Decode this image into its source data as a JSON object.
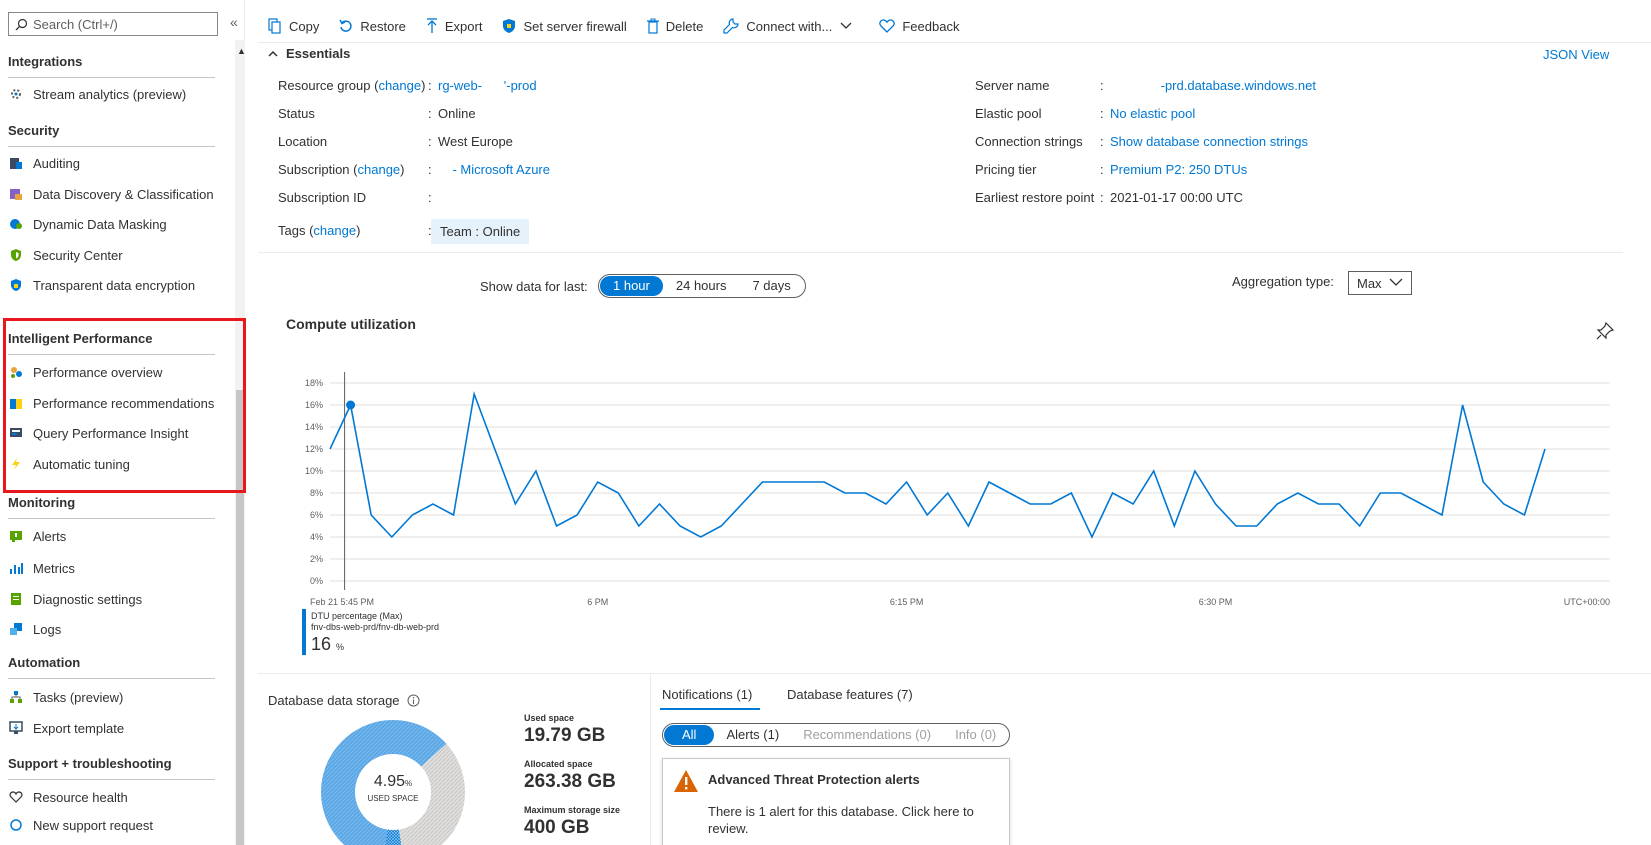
{
  "sidebar": {
    "search_placeholder": "Search (Ctrl+/)",
    "collapse": "«",
    "sections": [
      {
        "title": "Integrations",
        "items": [
          "Stream analytics (preview)"
        ]
      },
      {
        "title": "Security",
        "items": [
          "Auditing",
          "Data Discovery & Classification",
          "Dynamic Data Masking",
          "Security Center",
          "Transparent data encryption"
        ]
      },
      {
        "title": "Intelligent Performance",
        "items": [
          "Performance overview",
          "Performance recommendations",
          "Query Performance Insight",
          "Automatic tuning"
        ]
      },
      {
        "title": "Monitoring",
        "items": [
          "Alerts",
          "Metrics",
          "Diagnostic settings",
          "Logs"
        ]
      },
      {
        "title": "Automation",
        "items": [
          "Tasks (preview)",
          "Export template"
        ]
      },
      {
        "title": "Support + troubleshooting",
        "items": [
          "Resource health",
          "New support request"
        ]
      }
    ]
  },
  "toolbar": {
    "copy": "Copy",
    "restore": "Restore",
    "export": "Export",
    "firewall": "Set server firewall",
    "delete": "Delete",
    "connect": "Connect with...",
    "feedback": "Feedback"
  },
  "essentials": {
    "title": "Essentials",
    "json_view": "JSON View",
    "change": "change",
    "resource_group_label": "Resource group",
    "resource_group": "rg-web-   '-prod",
    "status_label": "Status",
    "status": "Online",
    "location_label": "Location",
    "location": "West Europe",
    "subscription_label": "Subscription",
    "subscription": "  - Microsoft Azure",
    "subscription_id_label": "Subscription ID",
    "subscription_id": "",
    "tags_label": "Tags",
    "tag": "Team : Online",
    "server_name_label": "Server name",
    "server_name": "       -prd.database.windows.net",
    "elastic_pool_label": "Elastic pool",
    "elastic_pool": "No elastic pool",
    "conn_label": "Connection strings",
    "conn": "Show database connection strings",
    "pricing_label": "Pricing tier",
    "pricing": "Premium P2: 250 DTUs",
    "restore_label": "Earliest restore point",
    "restore_point": "2021-01-17 00:00 UTC"
  },
  "controls": {
    "show_label": "Show data for last:",
    "ranges": [
      "1 hour",
      "24 hours",
      "7 days"
    ],
    "agg_label": "Aggregation type:",
    "agg_value": "Max"
  },
  "chart_data": {
    "type": "line",
    "title": "Compute utilization",
    "yticks": [
      "18%",
      "16%",
      "14%",
      "12%",
      "10%",
      "8%",
      "6%",
      "4%",
      "2%",
      "0%"
    ],
    "ylim": [
      0,
      18
    ],
    "xticks": [
      "Feb 21 5:45 PM",
      "6 PM",
      "6:15 PM",
      "6:30 PM"
    ],
    "timezone": "UTC+00:00",
    "series": [
      {
        "name": "DTU percentage (Max)",
        "values": [
          12,
          16,
          6,
          4,
          6,
          7,
          6,
          17,
          12,
          7,
          10,
          5,
          6,
          9,
          8,
          5,
          7,
          5,
          4,
          5,
          7,
          9,
          9,
          9,
          9,
          8,
          8,
          7,
          9,
          6,
          8,
          5,
          9,
          8,
          7,
          7,
          8,
          4,
          8,
          7,
          10,
          5,
          10,
          7,
          5,
          5,
          7,
          8,
          7,
          7,
          5,
          8,
          8,
          7,
          6,
          16,
          9,
          7,
          6,
          12
        ]
      }
    ],
    "cursor_index": 1,
    "legend": {
      "metric": "DTU percentage (Max)",
      "resource": "fnv-dbs-web-prd/fnv-db-web-prd",
      "value": "16",
      "unit": "%"
    }
  },
  "storage": {
    "title": "Database data storage",
    "percent": "4.95",
    "percent_unit": "%",
    "used_caption": "USED SPACE",
    "used_label": "Used space",
    "used": "19.79 GB",
    "allocated_label": "Allocated space",
    "allocated": "263.38 GB",
    "max_label": "Maximum storage size",
    "max": "400 GB",
    "allocated_fraction": 0.658
  },
  "notifications": {
    "tab_notifications": "Notifications (1)",
    "tab_features": "Database features (7)",
    "filters": [
      "All",
      "Alerts (1)",
      "Recommendations (0)",
      "Info (0)"
    ],
    "alert_title": "Advanced Threat Protection alerts",
    "alert_body": "There is 1 alert for this database. Click here to review."
  }
}
